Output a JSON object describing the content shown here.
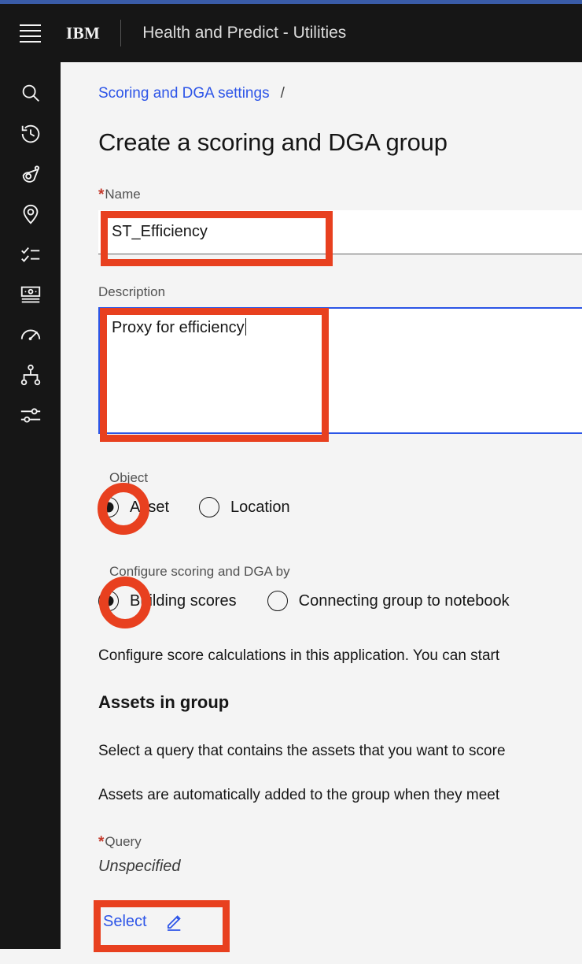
{
  "window": {
    "accent_strip_color": "#3a5ca8"
  },
  "header": {
    "menu_icon": "hamburger-menu-icon",
    "brand": "IBM",
    "title": "Health and Predict - Utilities",
    "background": "#161616"
  },
  "rail": {
    "items": [
      {
        "icon": "search-icon",
        "name": "search"
      },
      {
        "icon": "history-icon",
        "name": "history"
      },
      {
        "icon": "asset-icon",
        "name": "assets"
      },
      {
        "icon": "location-pin-icon",
        "name": "locations"
      },
      {
        "icon": "checklist-icon",
        "name": "work-orders"
      },
      {
        "icon": "money-bill-icon",
        "name": "costs"
      },
      {
        "icon": "gauge-icon",
        "name": "meters"
      },
      {
        "icon": "hierarchy-icon",
        "name": "hierarchy"
      },
      {
        "icon": "sliders-icon",
        "name": "settings"
      }
    ]
  },
  "breadcrumb": {
    "link": "Scoring and DGA settings",
    "separator": "/"
  },
  "page": {
    "title": "Create a scoring and DGA group"
  },
  "form": {
    "name": {
      "label": "Name",
      "required_marker": "*",
      "value": "ST_Efficiency"
    },
    "description": {
      "label": "Description",
      "value": "Proxy for efficiency",
      "focused": true
    },
    "object": {
      "label": "Object",
      "options": [
        {
          "label": "Asset",
          "selected": true
        },
        {
          "label": "Location",
          "selected": false
        }
      ]
    },
    "configure_by": {
      "label": "Configure scoring and DGA by",
      "options": [
        {
          "label": "Building scores",
          "selected": true
        },
        {
          "label": "Connecting group to notebook",
          "selected": false
        }
      ]
    },
    "helper_text": "Configure score calculations in this application. You can start",
    "assets_section": {
      "heading": "Assets in group",
      "paragraph_1": "Select a query that contains the assets that you want to score",
      "paragraph_2": "Assets are automatically added to the group when they meet"
    },
    "query": {
      "label": "Query",
      "required_marker": "*",
      "value": "Unspecified",
      "select_button": {
        "label": "Select",
        "icon": "edit-pencil-icon"
      }
    }
  },
  "annotations": {
    "color": "#e8401f",
    "boxes": [
      "name-input",
      "description-textarea",
      "select-button"
    ],
    "circles": [
      "object-asset-radio",
      "configure-building-scores-radio"
    ]
  },
  "colors": {
    "link": "#2d55e8",
    "focus_border": "#2b55e6",
    "required_star": "#c4392b",
    "page_background": "#f4f4f4",
    "header_background": "#161616"
  }
}
